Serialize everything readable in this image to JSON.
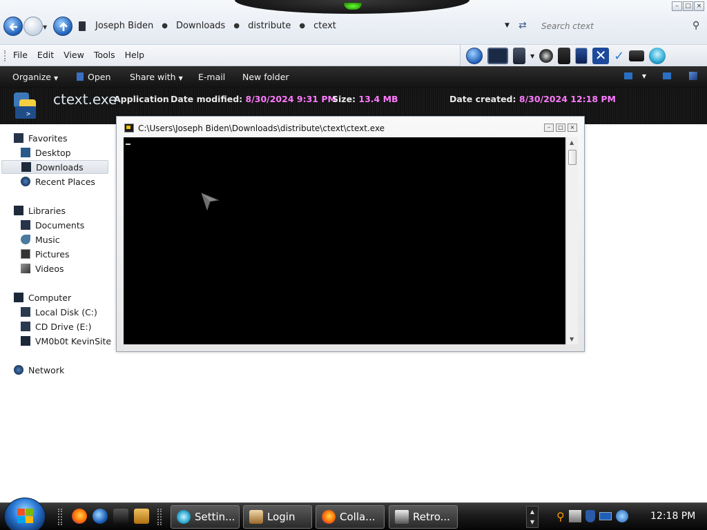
{
  "window": {
    "controls": [
      "–",
      "□",
      "×"
    ]
  },
  "address_bar": {
    "breadcrumbs": [
      "Joseph Biden",
      "Downloads",
      "distribute",
      "ctext"
    ],
    "search_placeholder": "Search ctext"
  },
  "menu": {
    "items": [
      "File",
      "Edit",
      "View",
      "Tools",
      "Help"
    ]
  },
  "command_bar": {
    "organize": "Organize",
    "open": "Open",
    "share_with": "Share with",
    "email": "E-mail",
    "new_folder": "New folder"
  },
  "details": {
    "file_name": "ctext.exe",
    "type": "Application",
    "date_modified_label": "Date modified:",
    "date_modified": "8/30/2024 9:31 PM",
    "size_label": "Size:",
    "size": "13.4 MB",
    "date_created_label": "Date created:",
    "date_created": "8/30/2024 12:18 PM"
  },
  "navigation": {
    "favorites": "Favorites",
    "desktop": "Desktop",
    "downloads": "Downloads",
    "recent_places": "Recent Places",
    "libraries": "Libraries",
    "documents": "Documents",
    "music": "Music",
    "pictures": "Pictures",
    "videos": "Videos",
    "computer": "Computer",
    "local_disk": "Local Disk (C:)",
    "cd_drive": "CD Drive (E:)",
    "network_share": "VM0b0t KevinSite",
    "network": "Network"
  },
  "console": {
    "title": "C:\\Users\\Joseph Biden\\Downloads\\distribute\\ctext\\ctext.exe"
  },
  "taskbar": {
    "buttons": [
      "Settin...",
      "Login",
      "Colla...",
      "Retro..."
    ],
    "clock": "12:18 PM"
  },
  "colors": {
    "detail_value": "#ff7aff",
    "console_bg": "#000000",
    "taskbar": "#1c1c1c"
  }
}
